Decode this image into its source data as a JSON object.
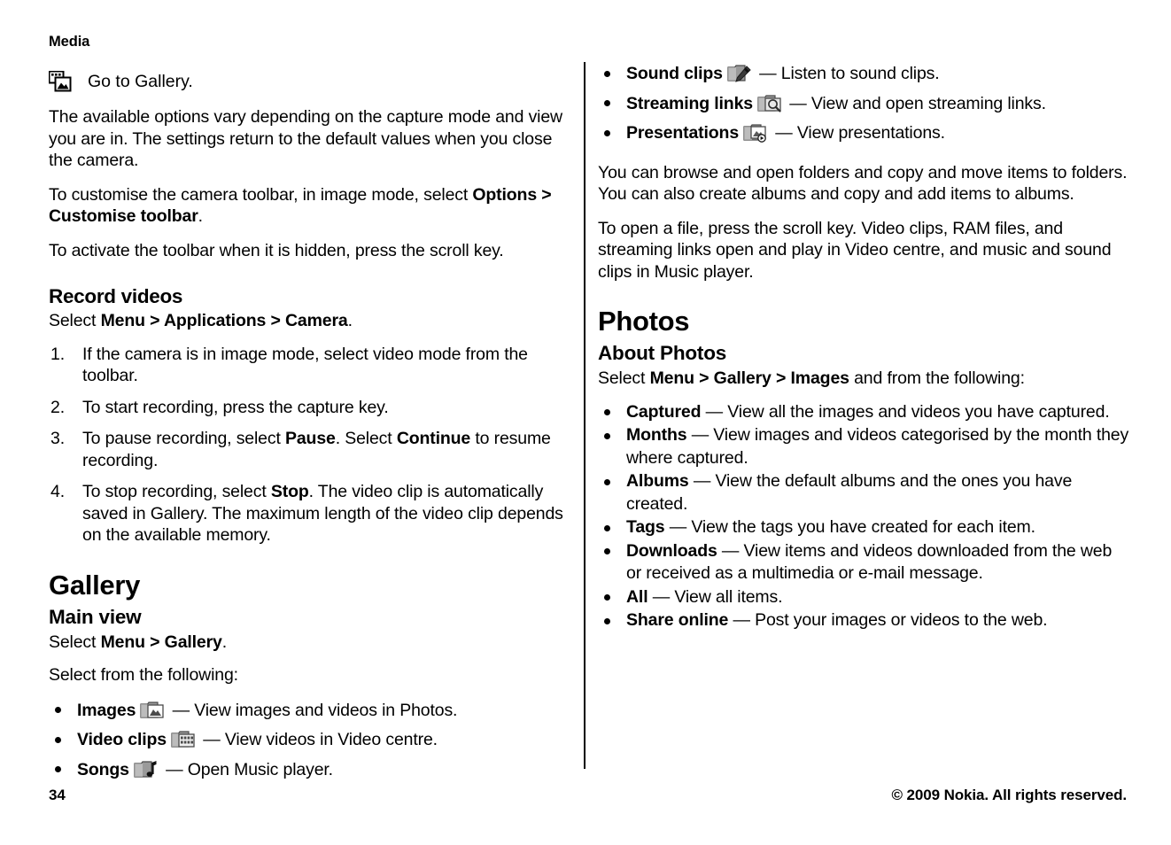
{
  "running_head": "Media",
  "left_column": {
    "gallery_shortcut": {
      "icon": "go-to-gallery-icon",
      "text": "Go to Gallery."
    },
    "para_options_vary": {
      "text": "The available options vary depending on the capture mode and view you are in. The settings return to the default values when you close the camera."
    },
    "para_customise": {
      "prefix": "To customise the camera toolbar, in image mode, select ",
      "bold1": "Options",
      "sep": " > ",
      "bold2": "Customise toolbar",
      "suffix": "."
    },
    "para_activate": {
      "text": "To activate the toolbar when it is hidden, press the scroll key."
    },
    "record_videos": {
      "heading": "Record videos",
      "select_prefix": "Select ",
      "select_bold1": "Menu",
      "select_sep1": " > ",
      "select_bold2": "Applications",
      "select_sep2": " > ",
      "select_bold3": "Camera",
      "select_suffix": ".",
      "steps": [
        {
          "num": "1.",
          "parts": [
            {
              "text": "If the camera is in image mode, select video mode from the toolbar.",
              "bold": false
            }
          ]
        },
        {
          "num": "2.",
          "parts": [
            {
              "text": "To start recording, press the capture key.",
              "bold": false
            }
          ]
        },
        {
          "num": "3.",
          "parts": [
            {
              "text": "To pause recording, select ",
              "bold": false
            },
            {
              "text": "Pause",
              "bold": true
            },
            {
              "text": ". Select ",
              "bold": false
            },
            {
              "text": "Continue",
              "bold": true
            },
            {
              "text": " to resume recording.",
              "bold": false
            }
          ]
        },
        {
          "num": "4.",
          "parts": [
            {
              "text": "To stop recording, select ",
              "bold": false
            },
            {
              "text": "Stop",
              "bold": true
            },
            {
              "text": ". The video clip is automatically saved in Gallery. The maximum length of the video clip depends on the available memory.",
              "bold": false
            }
          ]
        }
      ]
    },
    "gallery": {
      "heading": "Gallery",
      "subheading": "Main view",
      "select_prefix": "Select ",
      "select_bold1": "Menu",
      "select_sep1": " > ",
      "select_bold2": "Gallery",
      "select_suffix": ".",
      "select_following": "Select from the following:",
      "items": [
        {
          "term": "Images",
          "icon": "folder-images-icon",
          "desc": " — View images and videos in Photos."
        },
        {
          "term": "Video clips",
          "icon": "folder-video-icon",
          "desc": " — View videos in Video centre."
        },
        {
          "term": "Songs",
          "icon": "folder-music-icon",
          "desc": " — Open Music player."
        }
      ]
    }
  },
  "right_column": {
    "items_continued": [
      {
        "term": "Sound clips",
        "icon": "folder-sound-icon",
        "desc": " — Listen to sound clips."
      },
      {
        "term": "Streaming links",
        "icon": "folder-streaming-icon",
        "desc": " — View and open streaming links."
      },
      {
        "term": "Presentations",
        "icon": "folder-presentation-icon",
        "desc": " — View presentations."
      }
    ],
    "para_browse": {
      "text": "You can browse and open folders and copy and move items to folders. You can also create albums and copy and add items to albums."
    },
    "para_open_file": {
      "text": "To open a file, press the scroll key. Video clips, RAM files, and streaming links open and play in Video centre, and music and sound clips in Music player."
    },
    "photos": {
      "heading": "Photos",
      "subheading": "About Photos",
      "select_prefix": "Select ",
      "select_bold1": "Menu",
      "select_sep1": " > ",
      "select_bold2": "Gallery",
      "select_sep2": " > ",
      "select_bold3": "Images",
      "select_suffix": " and from the following:",
      "items": [
        {
          "term": "Captured",
          "desc": "  — View all the images and videos you have captured."
        },
        {
          "term": "Months",
          "desc": "  — View images and videos categorised by the month they where captured."
        },
        {
          "term": "Albums",
          "desc": " — View the default albums and the ones you have created."
        },
        {
          "term": "Tags",
          "desc": "  — View the tags you have created for each item."
        },
        {
          "term": "Downloads",
          "desc": "  — View items and videos downloaded from the web or received as a multimedia or e-mail message."
        },
        {
          "term": "All",
          "desc": "  — View all items."
        },
        {
          "term": "Share online",
          "desc": "  — Post your images or videos to the web."
        }
      ]
    }
  },
  "footer": {
    "page_number": "34",
    "copyright": "© 2009 Nokia. All rights reserved."
  },
  "colors": {
    "text": "#000000",
    "background": "#ffffff",
    "icon_light": "#d8d8d8",
    "icon_mid": "#9a9a9a",
    "icon_dark": "#4a4a4a"
  }
}
